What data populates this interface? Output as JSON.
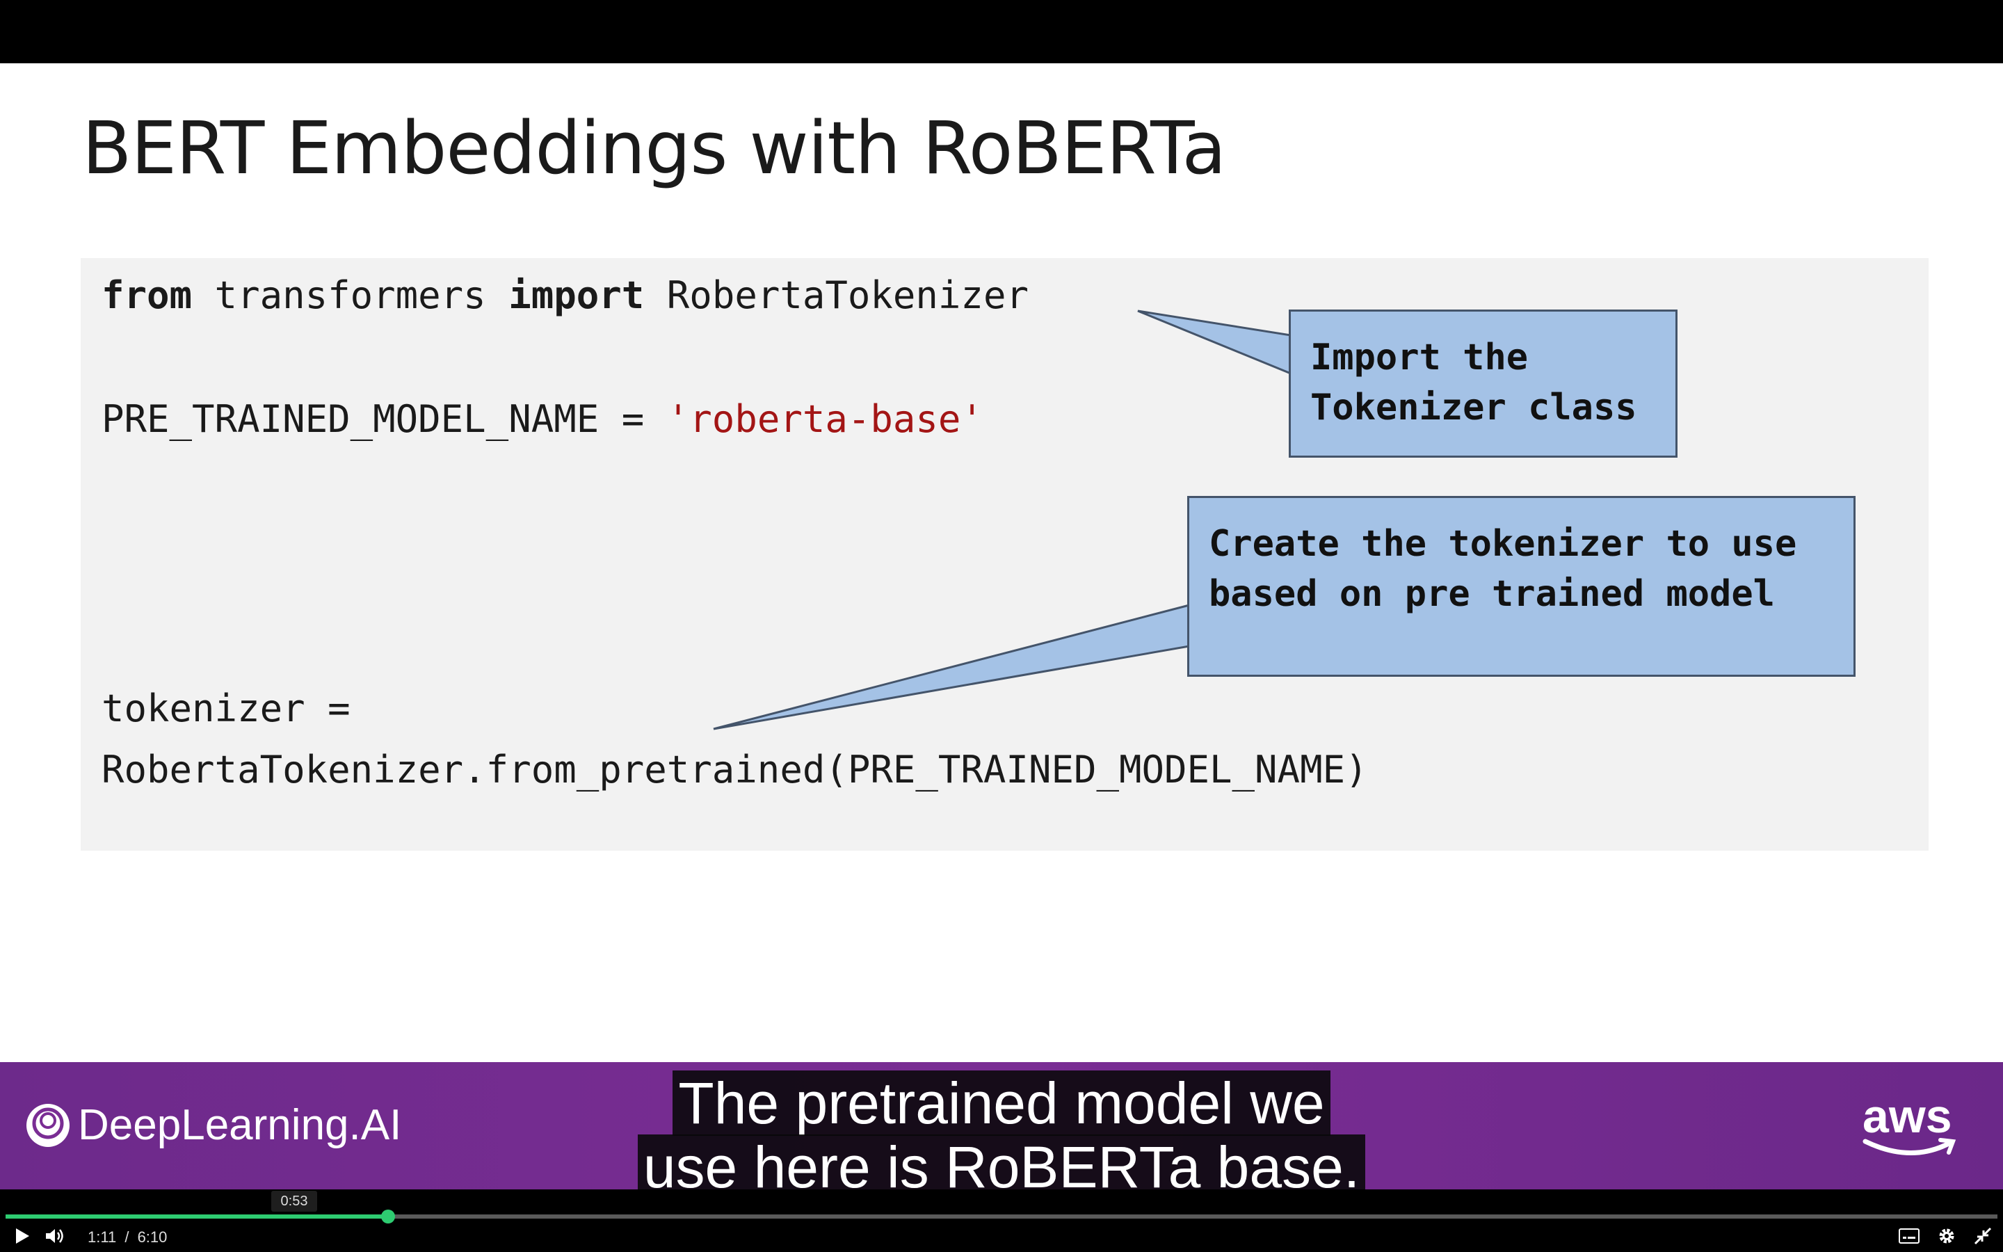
{
  "slide": {
    "title": "BERT Embeddings with RoBERTa",
    "code": {
      "line1": {
        "kw1": "from",
        "mod": " transformers ",
        "kw2": "import",
        "cls": " RobertaTokenizer"
      },
      "line2": {
        "lhs": "PRE_TRAINED_MODEL_NAME = ",
        "str": "'roberta-base'"
      },
      "line3": "tokenizer =",
      "line4": "RobertaTokenizer.from_pretrained(PRE_TRAINED_MODEL_NAME)"
    },
    "callout1": "Import the\nTokenizer class",
    "callout2": "Create the tokenizer to use\nbased on pre trained model"
  },
  "brand": {
    "left_logo": "DeepLearning.AI",
    "right_logo": "aws"
  },
  "caption": {
    "line1": "The pretrained model we",
    "line2": "use here is RoBERTa base."
  },
  "player": {
    "hover_time": "0:53",
    "current_time": "1:11",
    "separator": "/",
    "duration": "6:10",
    "progress_fraction": 0.192,
    "accent_color": "#2ecc71"
  }
}
